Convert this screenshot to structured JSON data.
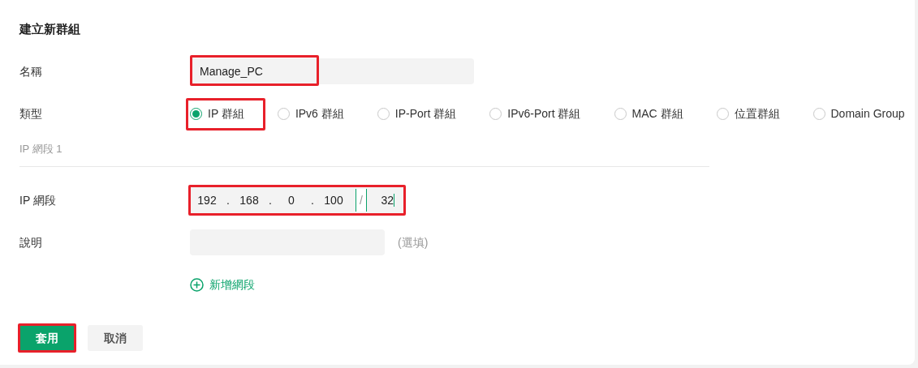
{
  "title": "建立新群組",
  "name": {
    "label": "名稱",
    "value": "Manage_PC",
    "highlighted": true
  },
  "type": {
    "label": "類型",
    "options": [
      {
        "label": "IP 群組",
        "selected": true,
        "highlighted": true
      },
      {
        "label": "IPv6 群組",
        "selected": false,
        "highlighted": false
      },
      {
        "label": "IP-Port 群組",
        "selected": false,
        "highlighted": false
      },
      {
        "label": "IPv6-Port 群組",
        "selected": false,
        "highlighted": false
      },
      {
        "label": "MAC 群組",
        "selected": false,
        "highlighted": false
      },
      {
        "label": "位置群組",
        "selected": false,
        "highlighted": false
      },
      {
        "label": "Domain Group",
        "selected": false,
        "highlighted": false
      }
    ]
  },
  "section": "IP 網段 1",
  "ip": {
    "label": "IP 網段",
    "octets": [
      "192",
      "168",
      "0",
      "100"
    ],
    "dots": [
      ".",
      ".",
      "."
    ],
    "slash": "/",
    "prefix": "32",
    "highlighted": true
  },
  "description": {
    "label": "說明",
    "hint": "(選填)"
  },
  "add_segment": "新增網段",
  "buttons": [
    {
      "kind": "primary",
      "label": "套用",
      "highlighted": true
    },
    {
      "kind": "secondary",
      "label": "取消",
      "highlighted": false
    }
  ]
}
